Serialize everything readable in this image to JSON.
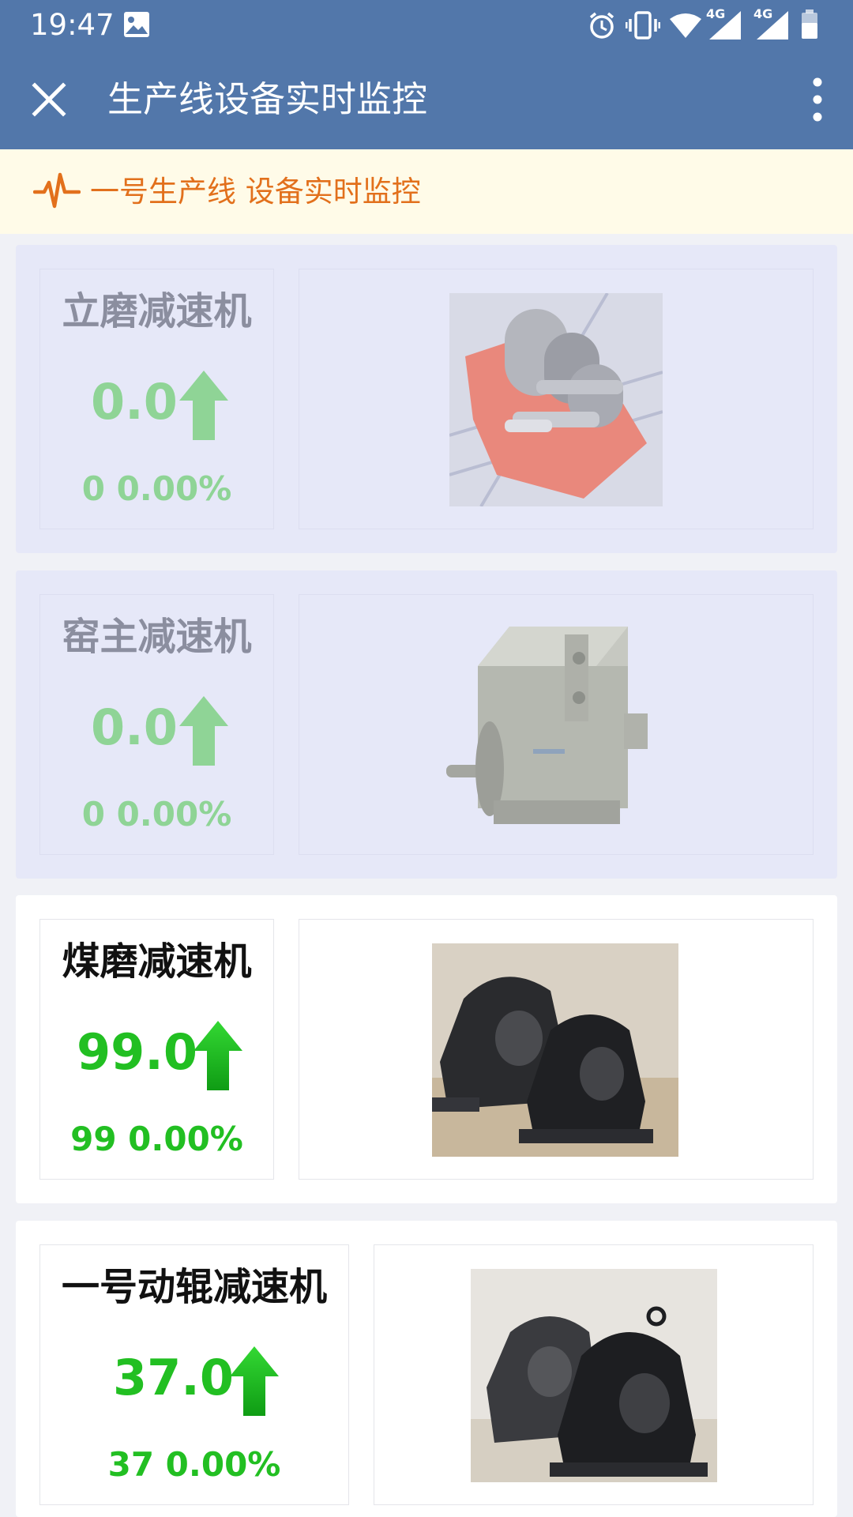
{
  "status_bar": {
    "time": "19:47",
    "network_labels": [
      "4G",
      "4G"
    ],
    "icons": [
      "image-icon",
      "alarm-icon",
      "vibrate-icon",
      "wifi-icon",
      "signal-icon",
      "signal-icon",
      "battery-icon"
    ]
  },
  "app_bar": {
    "title": "生产线设备实时监控",
    "close_icon": "close-icon",
    "more_icon": "more-vertical-icon"
  },
  "notice": {
    "icon": "pulse-icon",
    "text": "一号生产线 设备实时监控",
    "color": "#e2701c"
  },
  "colors": {
    "header": "#5277aa",
    "value_green": "#22bf22",
    "faded_green": "#8fd496",
    "faded_card": "#e6e8f8"
  },
  "devices": [
    {
      "name": "立磨减速机",
      "value": "0.0",
      "count": "0",
      "percent": "0.00%",
      "trend": "up",
      "status": "inactive",
      "image": "gear-reducer-photo"
    },
    {
      "name": "窑主减速机",
      "value": "0.0",
      "count": "0",
      "percent": "0.00%",
      "trend": "up",
      "status": "inactive",
      "image": "motor-photo"
    },
    {
      "name": "煤磨减速机",
      "value": "99.0",
      "count": "99",
      "percent": "0.00%",
      "trend": "up",
      "status": "active",
      "image": "bearing-housing-photo"
    },
    {
      "name": "一号动辊减速机",
      "value": "37.0",
      "count": "37",
      "percent": "0.00%",
      "trend": "up",
      "status": "active",
      "image": "bearing-housing-photo"
    }
  ]
}
